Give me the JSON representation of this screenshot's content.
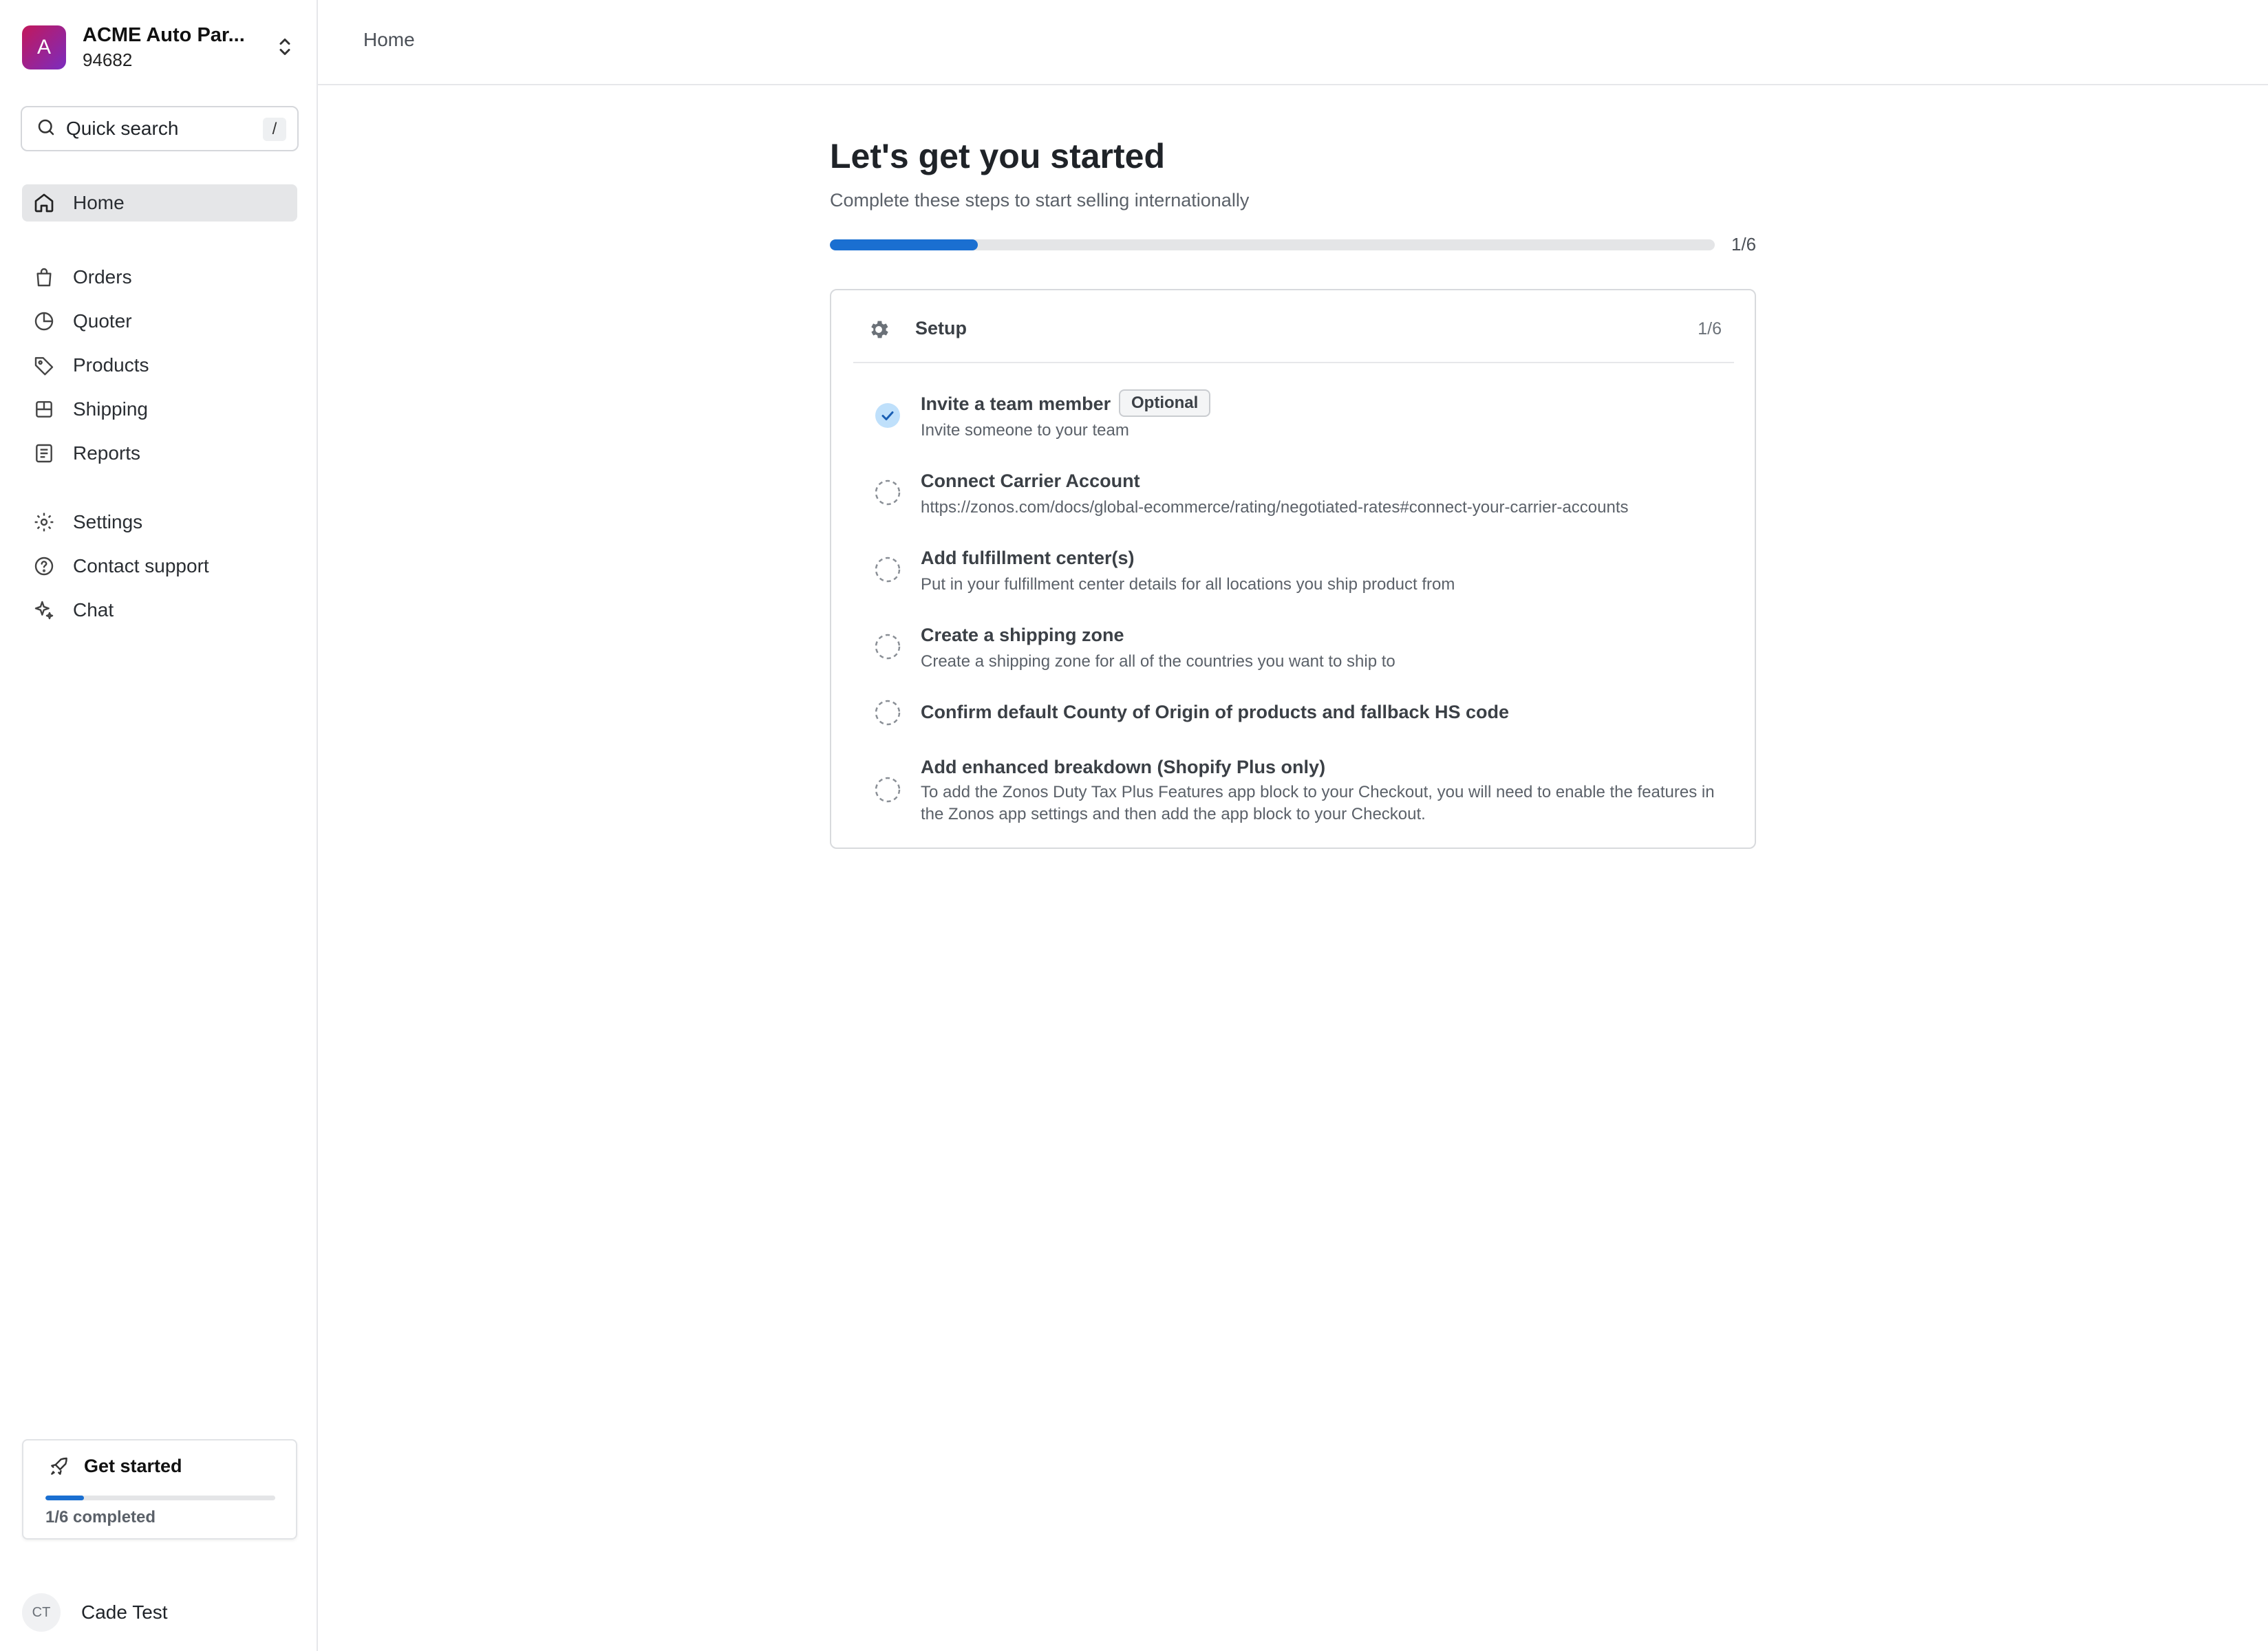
{
  "org": {
    "avatar_letter": "A",
    "name": "ACME Auto Par...",
    "id": "94682"
  },
  "search": {
    "label": "Quick search",
    "shortcut": "/"
  },
  "nav": {
    "home": "Home",
    "orders": "Orders",
    "quoter": "Quoter",
    "products": "Products",
    "shipping": "Shipping",
    "reports": "Reports",
    "settings": "Settings",
    "contact_support": "Contact support",
    "chat": "Chat"
  },
  "get_started": {
    "title": "Get started",
    "completed_text": "1/6 completed",
    "progress": 0.167
  },
  "user": {
    "initials": "CT",
    "name": "Cade Test"
  },
  "breadcrumb": {
    "current": "Home"
  },
  "main": {
    "title": "Let's get you started",
    "subtitle": "Complete these steps to start selling internationally",
    "progress_text": "1/6",
    "progress": 0.167
  },
  "setup": {
    "title": "Setup",
    "count": "1/6",
    "steps": [
      {
        "title": "Invite a team member",
        "badge": "Optional",
        "desc": "Invite someone to your team",
        "done": true
      },
      {
        "title": "Connect Carrier Account",
        "desc": "https://zonos.com/docs/global-ecommerce/rating/negotiated-rates#connect-your-carrier-accounts",
        "done": false
      },
      {
        "title": "Add fulfillment center(s)",
        "desc": "Put in your fulfillment center details for all locations you ship product from",
        "done": false
      },
      {
        "title": "Create a shipping zone",
        "desc": "Create a shipping zone for all of the countries you want to ship to",
        "done": false
      },
      {
        "title": "Confirm default County of Origin of products and fallback HS code",
        "desc": "",
        "done": false
      },
      {
        "title": "Add enhanced breakdown (Shopify Plus only)",
        "desc": "To add the Zonos Duty Tax Plus Features app block to your Checkout, you will need to enable the features in the Zonos app settings and then add the app block to your Checkout.",
        "done": false
      }
    ]
  },
  "colors": {
    "accent": "#1a6fd1",
    "check_done": "#bfe0fb"
  }
}
